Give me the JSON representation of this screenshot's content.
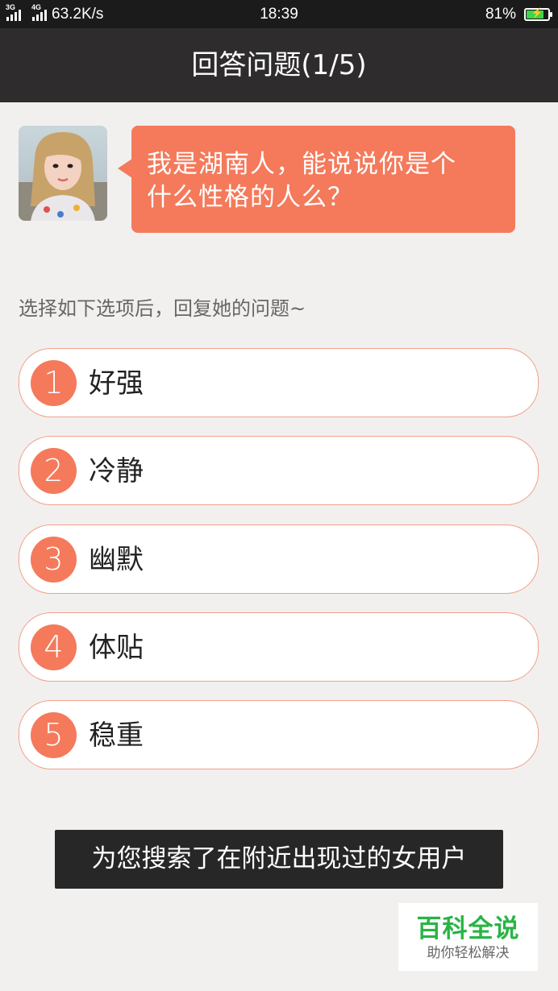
{
  "status_bar": {
    "sim1_net": "3G",
    "sim2_net": "4G",
    "speed": "63.2K/s",
    "time": "18:39",
    "battery_percent": "81%",
    "battery_level": 0.81,
    "battery_color": "#3fd44a"
  },
  "header": {
    "title": "回答问题(1/5)"
  },
  "chat": {
    "avatar": "avatar-photo",
    "question_line1": "我是湖南人，能说说你是个",
    "question_line2": "什么性格的人么？"
  },
  "prompt": "选择如下选项后，回复她的问题~",
  "options": [
    {
      "number": "1",
      "label": "好强"
    },
    {
      "number": "2",
      "label": "冷静"
    },
    {
      "number": "3",
      "label": "幽默"
    },
    {
      "number": "4",
      "label": "体贴"
    },
    {
      "number": "5",
      "label": "稳重"
    }
  ],
  "toast": "为您搜索了在附近出现过的女用户",
  "watermark": {
    "title": "百科全说",
    "subtitle": "助你轻松解决"
  },
  "colors": {
    "accent": "#f47a5b",
    "header_bg": "#2e2c2d",
    "background": "#f1f0ef"
  }
}
